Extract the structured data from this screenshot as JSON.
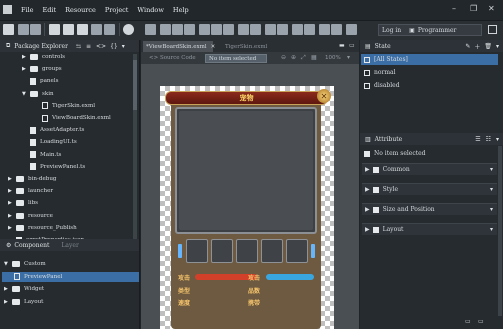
{
  "menu": [
    "File",
    "Edit",
    "Resource",
    "Project",
    "Window",
    "Help"
  ],
  "window_controls": {
    "minimize": "–",
    "restore": "❐",
    "close": "✕"
  },
  "toolbar": {
    "login_label": "Log in",
    "perspective": "Programmer"
  },
  "package_explorer": {
    "title": "Package Explorer",
    "items": [
      {
        "label": "controls",
        "kind": "folder",
        "depth": 2,
        "expanded": false
      },
      {
        "label": "groups",
        "kind": "folder",
        "depth": 2,
        "expanded": false
      },
      {
        "label": "panels",
        "kind": "file",
        "depth": 2
      },
      {
        "label": "skin",
        "kind": "folder",
        "depth": 2,
        "expanded": true
      },
      {
        "label": "TigerSkin.exml",
        "kind": "exml",
        "depth": 3
      },
      {
        "label": "ViewBoardSkin.exml",
        "kind": "exml",
        "depth": 3
      },
      {
        "label": "AssetAdapter.ts",
        "kind": "file",
        "depth": 2
      },
      {
        "label": "LoadingUI.ts",
        "kind": "file",
        "depth": 2
      },
      {
        "label": "Main.ts",
        "kind": "file",
        "depth": 2
      },
      {
        "label": "PreviewPanel.ts",
        "kind": "file",
        "depth": 2
      },
      {
        "label": "bin-debug",
        "kind": "folder",
        "depth": 1,
        "expanded": false
      },
      {
        "label": "launcher",
        "kind": "folder",
        "depth": 1,
        "expanded": false
      },
      {
        "label": "libs",
        "kind": "folder",
        "depth": 1,
        "expanded": false
      },
      {
        "label": "resource",
        "kind": "folder",
        "depth": 1,
        "expanded": false
      },
      {
        "label": "resource_Publish",
        "kind": "folder",
        "depth": 1,
        "expanded": false
      },
      {
        "label": "egretProperties.json",
        "kind": "file",
        "depth": 1
      }
    ]
  },
  "component_panel": {
    "tabs": [
      "Component",
      "Layer"
    ],
    "items": [
      {
        "label": "Custom",
        "kind": "category",
        "expanded": true,
        "depth": 0
      },
      {
        "label": "PreviewPanel",
        "kind": "component",
        "depth": 1,
        "selected": true
      },
      {
        "label": "Widget",
        "kind": "category",
        "expanded": false,
        "depth": 0
      },
      {
        "label": "Layout",
        "kind": "category",
        "expanded": false,
        "depth": 0
      }
    ]
  },
  "editor": {
    "tabs": [
      {
        "label": "*ViewBoardSkin.exml",
        "active": true
      },
      {
        "label": "TigerSkin.exml",
        "active": false
      }
    ],
    "modes": [
      "Source Code",
      "No item selected"
    ],
    "zoom": "100%"
  },
  "skin_preview": {
    "title": "宠物",
    "close_glyph": "✕",
    "slot_count": 5,
    "stats": [
      {
        "label": "攻击",
        "bar_color": "#d2402a"
      },
      {
        "label": "攻击",
        "bar_color": "#3aa6e0"
      },
      {
        "label": "类型"
      },
      {
        "label": "品数"
      },
      {
        "label": "速度"
      },
      {
        "label": "携带"
      }
    ]
  },
  "state_panel": {
    "title": "State",
    "items": [
      {
        "label": "[All States]",
        "selected": true
      },
      {
        "label": "normal",
        "selected": false
      },
      {
        "label": "disabled",
        "selected": false
      }
    ]
  },
  "attribute_panel": {
    "title": "Attribute",
    "status": "No item selected",
    "sections": [
      "Common",
      "Style",
      "Size and Position",
      "Layout"
    ]
  },
  "colors": {
    "bg": "#1f2428",
    "panel": "#262b30",
    "selection": "#3a6ea5",
    "title_red": "#8c2a1c",
    "gold": "#ffd76a",
    "slot_blue": "#66b6ff"
  }
}
